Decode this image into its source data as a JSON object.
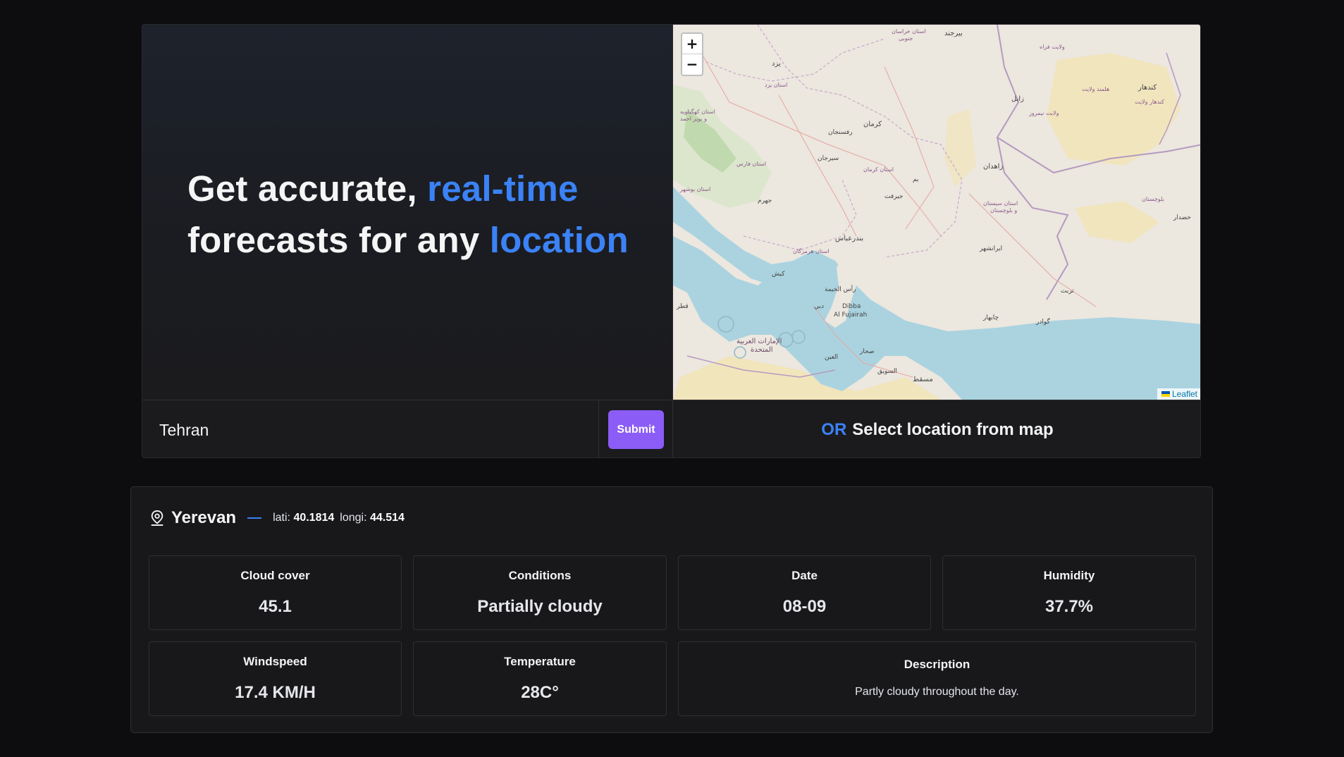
{
  "hero": {
    "headline_part1": "Get accurate, ",
    "headline_accent1": "real-time",
    "headline_part2": "forecasts for any ",
    "headline_accent2": "location"
  },
  "search": {
    "value": "Tehran",
    "submit_label": "Submit"
  },
  "map": {
    "zoom_in": "+",
    "zoom_out": "−",
    "attribution": "Leaflet",
    "labels": [
      "بیرجند",
      "استان خراسان جنوبی",
      "ولایت فراه",
      "یزد",
      "استان یزد",
      "زابل",
      "ولایت نیمروز",
      "هلمند ولایت",
      "کندهار",
      "کرمان",
      "رفسنجان",
      "سیرجان",
      "استان کرمان",
      "زاهدان",
      "بم",
      "جیرفت",
      "استان فارس",
      "جهرم",
      "استان سیستان و بلوچستان",
      "ایرانشهر",
      "بندرعباس",
      "استان هرمزگان",
      "کیش",
      "رأس الخيمة",
      "دبي",
      "Dibba Al Fujairah",
      "قطر",
      "الإمارات العربية المتحدة",
      "العين",
      "صحار",
      "السويق",
      "مسقط",
      "چابهار",
      "گوادر",
      "تربت",
      "خضدار",
      "بلوچستان"
    ]
  },
  "map_hint": {
    "or": "OR",
    "text": "Select location from map"
  },
  "weather": {
    "location": "Yerevan",
    "lat_label": "lati:",
    "lat": "40.1814",
    "lon_label": "longi:",
    "lon": "44.514",
    "stats": [
      {
        "label": "Cloud cover",
        "value": "45.1"
      },
      {
        "label": "Conditions",
        "value": "Partially cloudy"
      },
      {
        "label": "Date",
        "value": "08-09"
      },
      {
        "label": "Humidity",
        "value": "37.7%"
      },
      {
        "label": "Windspeed",
        "value": "17.4 KM/H"
      },
      {
        "label": "Temperature",
        "value": "28C°"
      }
    ],
    "description_label": "Description",
    "description": "Partly cloudy throughout the day."
  },
  "colors": {
    "accent": "#3b82f6",
    "button": "#8b5cf6",
    "background": "#0d0d0f",
    "card": "#1b1b1e"
  }
}
